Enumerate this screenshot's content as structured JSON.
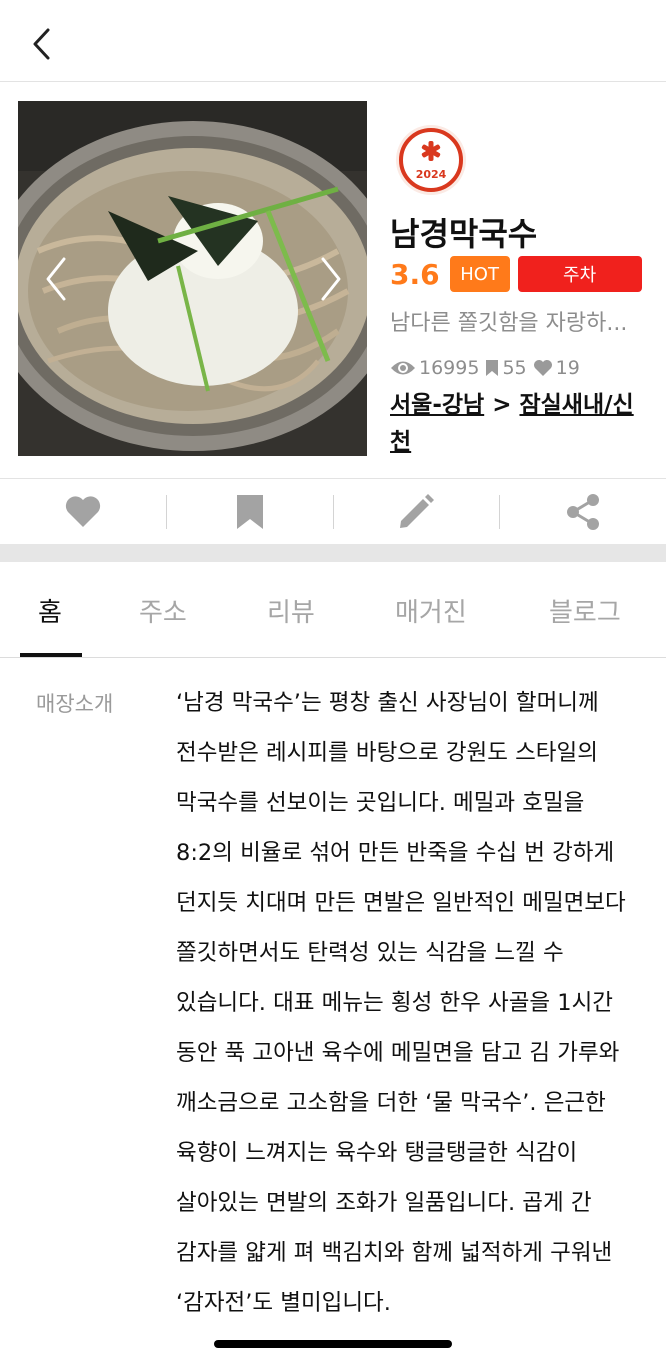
{
  "header": {
    "back_icon": "chevron-left-icon"
  },
  "restaurant": {
    "badge_year": "2024",
    "name": "남경막국수",
    "rating": "3.6",
    "hot_tag": "HOT",
    "parking_tag": "주차",
    "description": "남다른 쫄깃함을 자랑하...",
    "views": "16995",
    "bookmarks": "55",
    "likes": "19",
    "location_region": "서울-강남",
    "location_separator": " > ",
    "location_area": "잠실새내/신천"
  },
  "actions": {
    "icons": [
      "heart-icon",
      "bookmark-icon",
      "pencil-icon",
      "share-icon"
    ]
  },
  "tabs": [
    {
      "label": "홈",
      "active": true
    },
    {
      "label": "주소",
      "active": false
    },
    {
      "label": "리뷰",
      "active": false
    },
    {
      "label": "매거진",
      "active": false
    },
    {
      "label": "블로그",
      "active": false
    }
  ],
  "intro": {
    "label": "매장소개",
    "text": "‘남경 막국수’는 평창 출신 사장님이 할머니께 전수받은 레시피를 바탕으로 강원도 스타일의 막국수를 선보이는 곳입니다. 메밀과 호밀을 8:2의 비율로 섞어 만든 반죽을 수십 번 강하게 던지듯 치대며 만든 면발은 일반적인 메밀면보다 쫄깃하면서도 탄력성 있는 식감을 느낄 수 있습니다. 대표 메뉴는 횡성 한우 사골을 1시간 동안 푹 고아낸 육수에 메밀면을 담고 김 가루와 깨소금으로 고소함을 더한 ‘물 막국수’. 은근한 육향이 느껴지는 육수와 탱글탱글한 식감이 살아있는 면발의 조화가 일품입니다. 곱게 간 감자를 얇게 펴 백김치와 함께 넓적하게 구워낸 ‘감자전’도 별미입니다."
  },
  "colors": {
    "accent_orange": "#ff7a1a",
    "parking_red": "#f0211d",
    "muted_gray": "#8d8d8d"
  }
}
